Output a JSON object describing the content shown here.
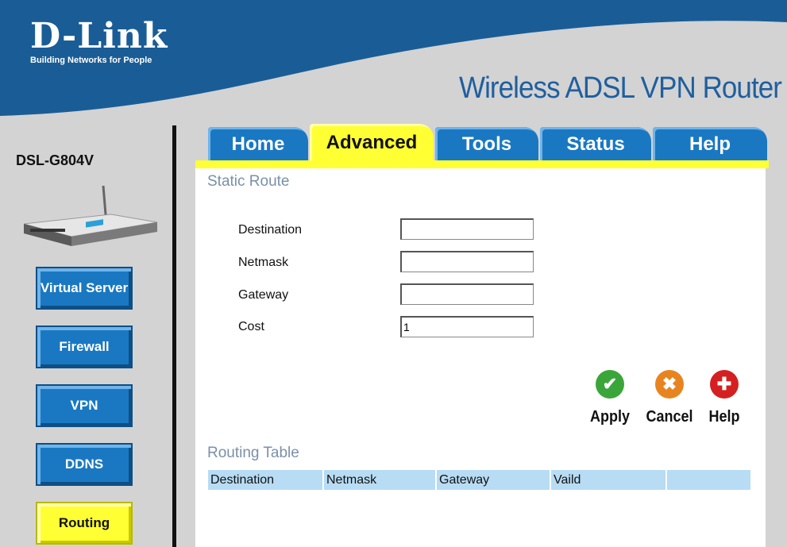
{
  "header": {
    "brand": "D-Link",
    "tagline": "Building Networks for People",
    "product_title": "Wireless ADSL VPN Router"
  },
  "sidebar": {
    "model": "DSL-G804V",
    "items": [
      {
        "label": "Virtual Server"
      },
      {
        "label": "Firewall"
      },
      {
        "label": "VPN"
      },
      {
        "label": "DDNS"
      },
      {
        "label": "Routing",
        "active": true
      }
    ]
  },
  "tabs": [
    {
      "label": "Home"
    },
    {
      "label": "Advanced",
      "active": true
    },
    {
      "label": "Tools"
    },
    {
      "label": "Status"
    },
    {
      "label": "Help"
    }
  ],
  "static_route": {
    "title": "Static Route",
    "fields": [
      {
        "label": "Destination",
        "value": ""
      },
      {
        "label": "Netmask",
        "value": ""
      },
      {
        "label": "Gateway",
        "value": ""
      },
      {
        "label": "Cost",
        "value": "1"
      }
    ]
  },
  "actions": {
    "apply": "Apply",
    "cancel": "Cancel",
    "help": "Help"
  },
  "routing_table": {
    "title": "Routing Table",
    "columns": [
      "Destination",
      "Netmask",
      "Gateway",
      "Vaild",
      ""
    ]
  },
  "colors": {
    "header_blue": "#1a5d96",
    "tab_blue": "#1a78c2",
    "active_yellow": "#ffff33",
    "sidebar_gray": "#d3d3d3",
    "table_header": "#b7dcf4",
    "apply_green": "#3aa63a",
    "cancel_orange": "#e88420",
    "help_red": "#d42020"
  }
}
